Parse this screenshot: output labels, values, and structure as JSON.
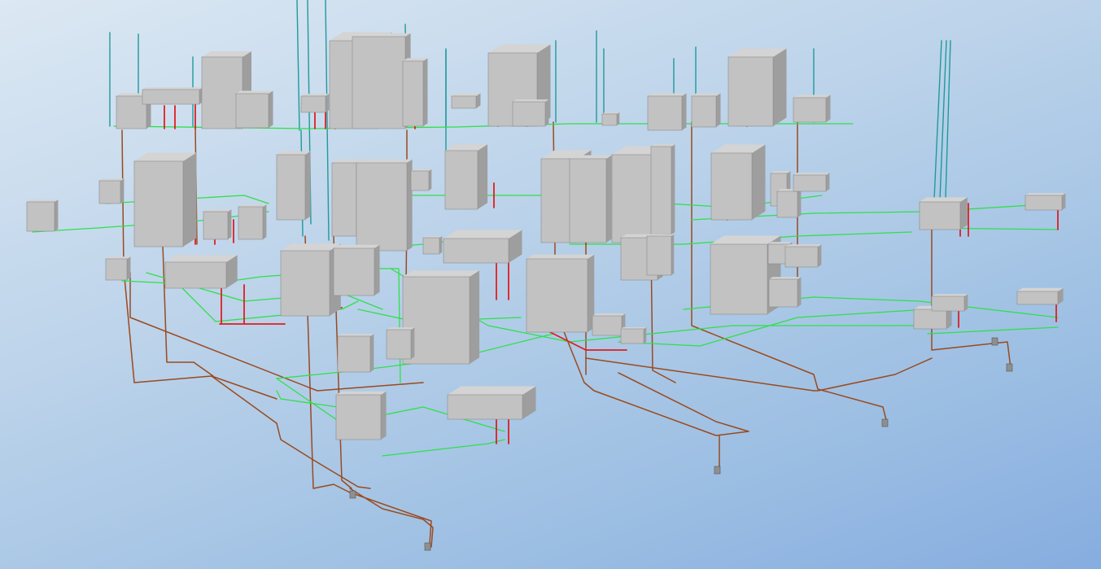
{
  "viewer": {
    "mode": "3d-plumbing-view",
    "background": {
      "top": "#dce8f3",
      "bottom": "#86ade0"
    }
  },
  "legend_colors": {
    "cold_water": "#2ee04a",
    "hot_water": "#e01e1e",
    "drainage": "#9a4a1e",
    "vent": "#1f9a9a",
    "fixture": "#c4c4c4"
  },
  "icons": [
    "fixture-icon",
    "pipe-run-icon",
    "riser-icon",
    "drain-outlet-icon"
  ]
}
